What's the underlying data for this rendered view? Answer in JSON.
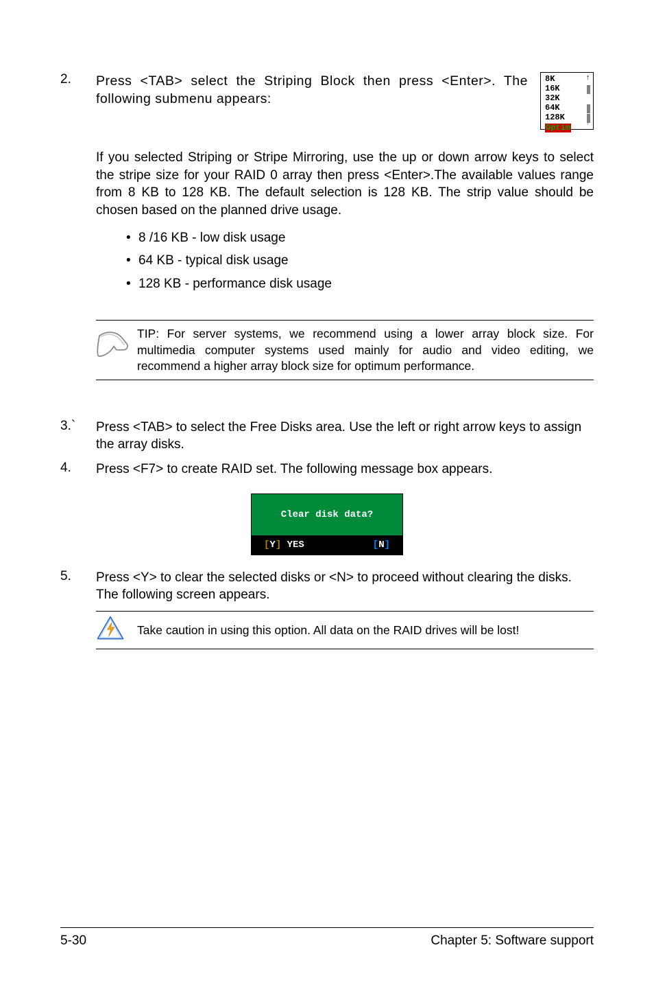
{
  "step2": {
    "num": "2.",
    "text": "Press <TAB> select the Striping Block then press <Enter>. The following submenu appears:"
  },
  "stripe_menu": {
    "items": [
      "8K",
      "16K",
      "32K",
      "64K",
      "128K"
    ],
    "selected_label": "Optim",
    "arrow_up": "↑",
    "arrow_dn": "↓"
  },
  "para1": "If you selected Striping or Stripe Mirroring, use the up or down arrow keys to select the stripe size for your RAID 0 array then press <Enter>.The available values range from 8 KB to 128 KB. The default selection is 128 KB. The strip value should be chosen based on the planned drive usage.",
  "bullets": [
    "8 /16 KB - low disk usage",
    "64 KB - typical disk usage",
    "128 KB - performance disk usage"
  ],
  "tip": "TIP: For server systems, we recommend using a lower array block size. For multimedia computer systems used mainly for audio and video editing, we recommend a higher array block size for optimum performance.",
  "step3": {
    "num": "3.`",
    "text": "Press <TAB> to select the Free Disks area. Use the left or right arrow keys to assign the array disks."
  },
  "step4": {
    "num": "4.",
    "text": "Press <F7> to create RAID set. The following message box appears."
  },
  "dialog": {
    "title": "Clear disk data?",
    "yes_bracket_l": "[",
    "yes_key": "Y",
    "yes_bracket_r": "]",
    "yes_label": " YES",
    "no_bracket_l": "[",
    "no_key": "N",
    "no_bracket_r": "]"
  },
  "step5": {
    "num": "5.",
    "text": "Press <Y> to clear the selected disks or <N> to proceed without clearing the disks. The following screen appears."
  },
  "warn": "Take caution in using this option. All data on the RAID drives will be lost!",
  "footer": {
    "left": "5-30",
    "right": "Chapter 5: Software support"
  }
}
